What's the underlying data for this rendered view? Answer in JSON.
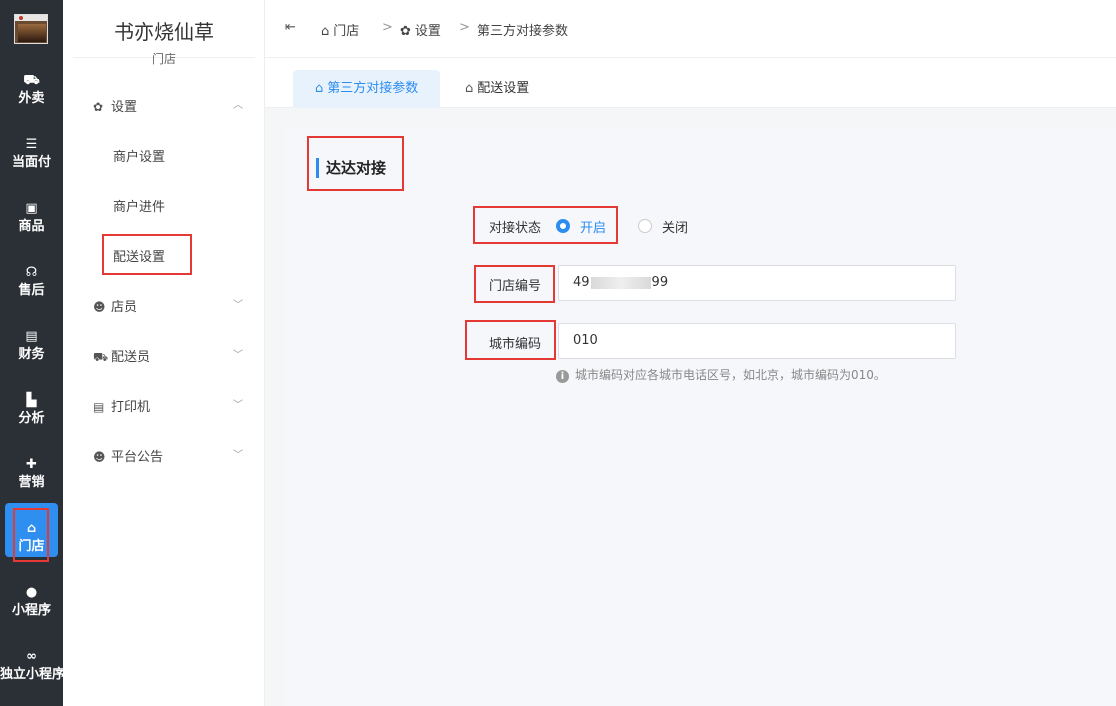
{
  "leftnav": {
    "items": [
      {
        "icon": "scooter-icon",
        "glyph": "⛟",
        "label": "外卖"
      },
      {
        "icon": "list-icon",
        "glyph": "☰",
        "label": "当面付"
      },
      {
        "icon": "gift-box-icon",
        "glyph": "▣",
        "label": "商品"
      },
      {
        "icon": "headset-icon",
        "glyph": "☊",
        "label": "售后"
      },
      {
        "icon": "finance-icon",
        "glyph": "▤",
        "label": "财务"
      },
      {
        "icon": "bar-chart-icon",
        "glyph": "▙",
        "label": "分析"
      },
      {
        "icon": "gift-icon",
        "glyph": "✚",
        "label": "营销"
      },
      {
        "icon": "store-icon",
        "glyph": "⌂",
        "label": "门店"
      },
      {
        "icon": "wechat-icon",
        "glyph": "●",
        "label": "小程序"
      },
      {
        "icon": "link-icon",
        "glyph": "∞",
        "label": "独立小程序"
      }
    ],
    "active_index": 7
  },
  "store": {
    "name": "书亦烧仙草",
    "subtitle": "门店"
  },
  "submenu": {
    "settings": {
      "label": "设置",
      "icon": "gear-icon"
    },
    "settings_children": [
      "商户设置",
      "商户进件",
      "配送设置"
    ],
    "groups": [
      {
        "label": "店员",
        "icon": "staff-icon"
      },
      {
        "label": "配送员",
        "icon": "courier-icon"
      },
      {
        "label": "打印机",
        "icon": "printer-icon"
      },
      {
        "label": "平台公告",
        "icon": "announcement-icon"
      }
    ]
  },
  "breadcrumb": {
    "collapse_glyph": "⇤",
    "items": [
      "门店",
      "设置",
      "第三方对接参数"
    ],
    "separator": ">"
  },
  "tabs": [
    {
      "label": "第三方对接参数",
      "active": true
    },
    {
      "label": "配送设置",
      "active": false
    }
  ],
  "section": {
    "title": "达达对接"
  },
  "form": {
    "status_label": "对接状态",
    "status_on": "开启",
    "status_off": "关闭",
    "status_value": "开启",
    "store_no_label": "门店编号",
    "store_no_prefix": "49",
    "store_no_suffix": "99",
    "city_code_label": "城市编码",
    "city_code_value": "010",
    "hint": "城市编码对应各城市电话区号，如北京，城市编码为010。"
  },
  "colors": {
    "nav_bg": "#2b3036",
    "accent": "#2d8cf0",
    "highlight_box": "#e53935"
  }
}
